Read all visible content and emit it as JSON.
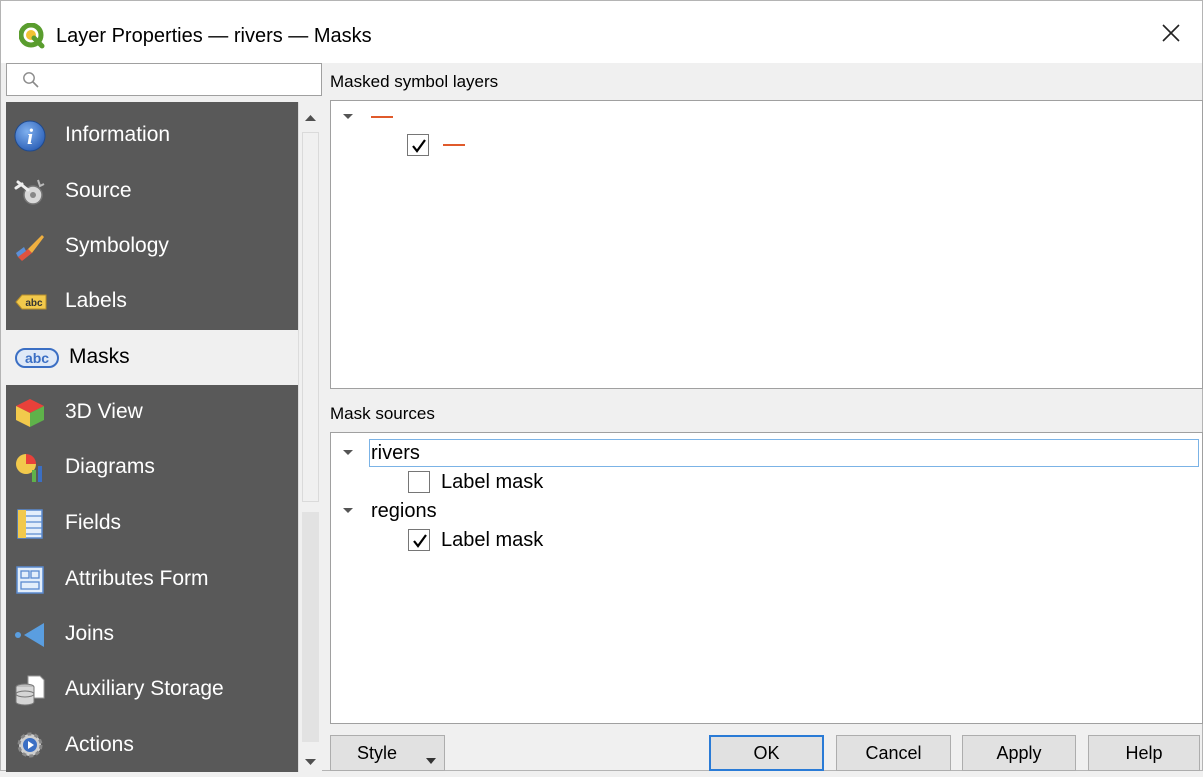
{
  "window": {
    "title": "Layer Properties — rivers — Masks",
    "app_icon": "qgis-icon",
    "close_icon": "close-icon"
  },
  "sidebar": {
    "search": {
      "value": "",
      "placeholder": "",
      "icon": "search-icon"
    },
    "items": [
      {
        "label": "Information",
        "icon": "information-icon",
        "active": false
      },
      {
        "label": "Source",
        "icon": "source-icon",
        "active": false
      },
      {
        "label": "Symbology",
        "icon": "symbology-icon",
        "active": false
      },
      {
        "label": "Labels",
        "icon": "labels-icon",
        "active": false
      },
      {
        "label": "Masks",
        "icon": "masks-icon",
        "active": true
      },
      {
        "label": "3D View",
        "icon": "3d-view-icon",
        "active": false
      },
      {
        "label": "Diagrams",
        "icon": "diagrams-icon",
        "active": false
      },
      {
        "label": "Fields",
        "icon": "fields-icon",
        "active": false
      },
      {
        "label": "Attributes Form",
        "icon": "attributes-form-icon",
        "active": false
      },
      {
        "label": "Joins",
        "icon": "joins-icon",
        "active": false
      },
      {
        "label": "Auxiliary Storage",
        "icon": "auxiliary-storage-icon",
        "active": false
      },
      {
        "label": "Actions",
        "icon": "actions-icon",
        "active": false
      }
    ]
  },
  "masked_symbol_layers": {
    "title": "Masked symbol layers",
    "symbol_color": "#e05a2b",
    "items": [
      {
        "expanded": true,
        "children": [
          {
            "checked": true
          }
        ]
      }
    ]
  },
  "mask_sources": {
    "title": "Mask sources",
    "layers": [
      {
        "name": "rivers",
        "expanded": true,
        "selected": true,
        "children": [
          {
            "label": "Label mask",
            "checked": false
          }
        ]
      },
      {
        "name": "regions",
        "expanded": true,
        "selected": false,
        "children": [
          {
            "label": "Label mask",
            "checked": true
          }
        ]
      }
    ]
  },
  "buttons": {
    "style": "Style",
    "ok": "OK",
    "cancel": "Cancel",
    "apply": "Apply",
    "help": "Help"
  },
  "colors": {
    "sidebar_bg": "#595959",
    "selection_border": "#7bb3e6",
    "default_button_border": "#2a7bd6"
  }
}
